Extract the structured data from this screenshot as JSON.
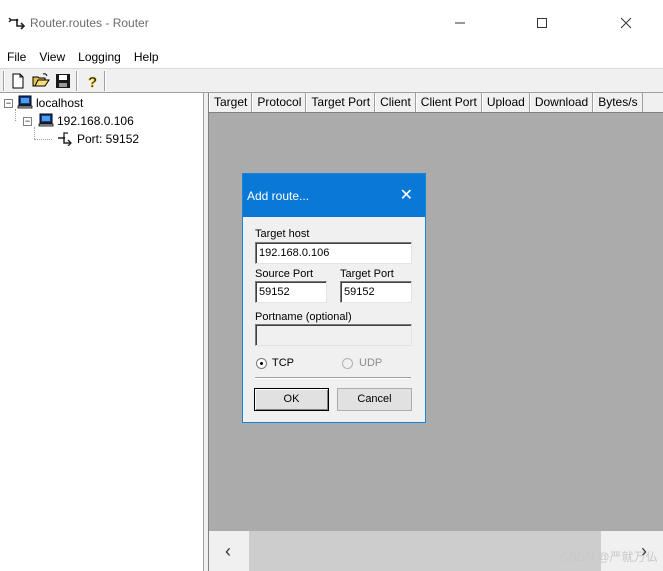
{
  "window": {
    "title": "Router.routes - Router",
    "icons": {
      "app": "router-icon",
      "minimize": "minimize-icon",
      "maximize": "maximize-icon",
      "close": "close-icon"
    }
  },
  "menu": {
    "file": "File",
    "view": "View",
    "logging": "Logging",
    "help": "Help"
  },
  "toolbar": {
    "icons": [
      "new-document-icon",
      "open-folder-icon",
      "save-icon",
      "help-icon"
    ]
  },
  "tree": {
    "root": {
      "label": "localhost",
      "icon": "computer-icon"
    },
    "host": {
      "label": "192.168.0.106",
      "icon": "computer-icon"
    },
    "port": {
      "label": "Port: 59152",
      "icon": "network-icon"
    }
  },
  "list": {
    "columns": [
      "Target",
      "Protocol",
      "Target Port",
      "Client",
      "Client Port",
      "Upload",
      "Download",
      "Bytes/s"
    ]
  },
  "scrollbar": {
    "left_arrow": "‹",
    "right_arrow": "›"
  },
  "watermark": "CSDN @严就万仏",
  "dialog": {
    "title": "Add route...",
    "close_glyph": "✕",
    "target_host_label": "Target host",
    "target_host_value": "192.168.0.106",
    "source_port_label": "Source Port",
    "source_port_value": "59152",
    "target_port_label": "Target Port",
    "target_port_value": "59152",
    "portname_label": "Portname (optional)",
    "portname_value": "",
    "protocol": {
      "tcp": "TCP",
      "udp": "UDP",
      "selected": "TCP"
    },
    "ok": "OK",
    "cancel": "Cancel"
  },
  "colors": {
    "dialog_titlebar": "#0a78d7",
    "workspace": "#ababab",
    "chrome": "#f0f0f0"
  }
}
